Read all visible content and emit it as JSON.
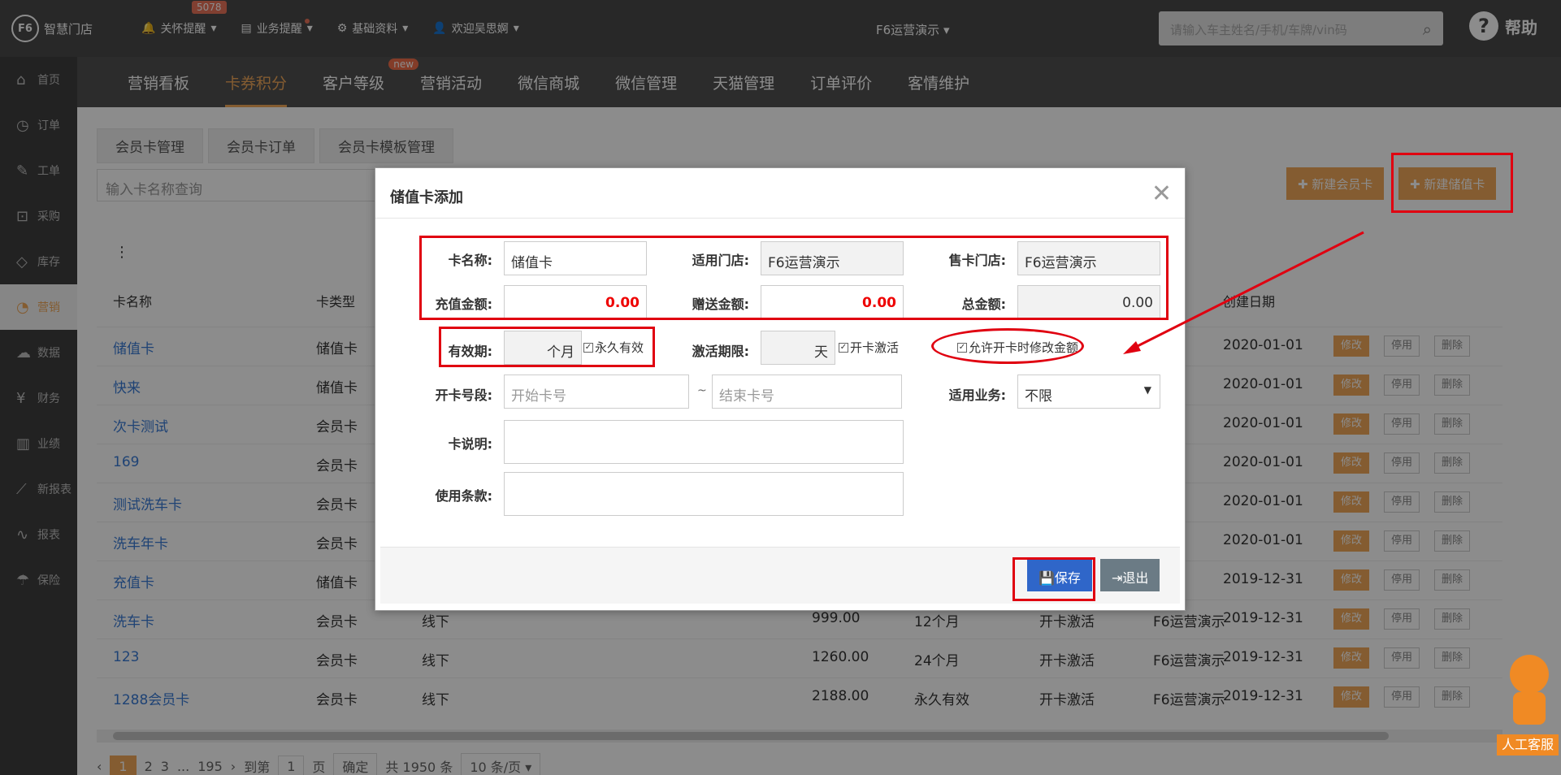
{
  "topbar": {
    "logo": "智慧门店",
    "logo_mark": "F6",
    "nav": [
      {
        "icon": "bell-icon",
        "label": "关怀提醒",
        "badge": "5078"
      },
      {
        "icon": "doc-icon",
        "label": "业务提醒"
      },
      {
        "icon": "gear-icon",
        "label": "基础资料"
      },
      {
        "icon": "user-icon",
        "label": "欢迎吴思婀"
      }
    ],
    "store": "F6运营演示",
    "search_placeholder": "请输入车主姓名/手机/车牌/vin码",
    "help": "帮助"
  },
  "sidebar": [
    {
      "icon": "home-icon",
      "label": "首页"
    },
    {
      "icon": "order-icon",
      "label": "订单"
    },
    {
      "icon": "wrench-icon",
      "label": "工单"
    },
    {
      "icon": "cart-icon",
      "label": "采购"
    },
    {
      "icon": "box-icon",
      "label": "库存"
    },
    {
      "icon": "pie-icon",
      "label": "营销",
      "active": true
    },
    {
      "icon": "cloud-icon",
      "label": "数据"
    },
    {
      "icon": "yen-icon",
      "label": "财务"
    },
    {
      "icon": "bars-icon",
      "label": "业绩"
    },
    {
      "icon": "line-icon",
      "label": "新报表"
    },
    {
      "icon": "chart-icon",
      "label": "报表"
    },
    {
      "icon": "umbrella-icon",
      "label": "保险"
    }
  ],
  "subnav": [
    "营销看板",
    "卡券积分",
    "客户等级",
    "营销活动",
    "微信商城",
    "微信管理",
    "天猫管理",
    "订单评价",
    "客情维护"
  ],
  "subnav_new_tag": "new",
  "content": {
    "tabs": [
      "会员卡管理",
      "会员卡订单",
      "会员卡模板管理"
    ],
    "search_placeholder": "输入卡名称查询",
    "btn_new_member": "✚ 新建会员卡",
    "btn_new_stored": "✚ 新建储值卡",
    "columns": [
      "卡名称",
      "卡类型",
      "创建日期"
    ],
    "rows": [
      {
        "name": "储值卡",
        "type": "储值卡",
        "date": "2020-01-01"
      },
      {
        "name": "快来",
        "type": "储值卡",
        "date": "2020-01-01"
      },
      {
        "name": "次卡测试",
        "type": "会员卡",
        "date": "2020-01-01"
      },
      {
        "name": "169",
        "type": "会员卡",
        "date": "2020-01-01"
      },
      {
        "name": "测试洗车卡",
        "type": "会员卡",
        "date": "2020-01-01"
      },
      {
        "name": "洗车年卡",
        "type": "会员卡",
        "date": "2020-01-01"
      },
      {
        "name": "充值卡",
        "type": "储值卡",
        "date": "2019-12-31"
      },
      {
        "name": "洗车卡",
        "type": "会员卡",
        "channel": "线下",
        "amount": "999.00",
        "period": "12个月",
        "act": "开卡激活",
        "store": "F6运营演示",
        "date": "2019-12-31"
      },
      {
        "name": "123",
        "type": "会员卡",
        "channel": "线下",
        "amount": "1260.00",
        "period": "24个月",
        "act": "开卡激活",
        "store": "F6运营演示",
        "date": "2019-12-31"
      },
      {
        "name": "1288会员卡",
        "type": "会员卡",
        "channel": "线下",
        "amount": "2188.00",
        "period": "永久有效",
        "act": "开卡激活",
        "store": "F6运营演示",
        "date": "2019-12-31"
      }
    ],
    "ops": [
      "修改",
      "停用",
      "删除"
    ],
    "pager": {
      "pages": [
        "1",
        "2",
        "3",
        "...",
        "195"
      ],
      "goto": "到第",
      "goto_val": "1",
      "page_unit": "页",
      "confirm": "确定",
      "total": "共 1950 条",
      "per_page": "10 条/页"
    }
  },
  "modal": {
    "title": "储值卡添加",
    "close": "✕",
    "card_name_label": "卡名称:",
    "card_name": "储值卡",
    "store_label": "适用门店:",
    "store": "F6运营演示",
    "sell_store_label": "售卡门店:",
    "sell_store": "F6运营演示",
    "recharge_label": "充值金额:",
    "recharge": "0.00",
    "gift_label": "赠送金额:",
    "gift": "0.00",
    "total_label": "总金额:",
    "total": "0.00",
    "validity_label": "有效期:",
    "validity_unit": "个月",
    "forever": "永久有效",
    "activate_label": "激活期限:",
    "activate_unit": "天",
    "open_activate": "开卡激活",
    "allow_modify": "允许开卡时修改金额",
    "range_label": "开卡号段:",
    "start_ph": "开始卡号",
    "tilde": "~",
    "end_ph": "结束卡号",
    "business_label": "适用业务:",
    "business": "不限",
    "desc_label": "卡说明:",
    "terms_label": "使用条款:",
    "save": "保存",
    "exit": "退出"
  },
  "assistant": "人工客服"
}
